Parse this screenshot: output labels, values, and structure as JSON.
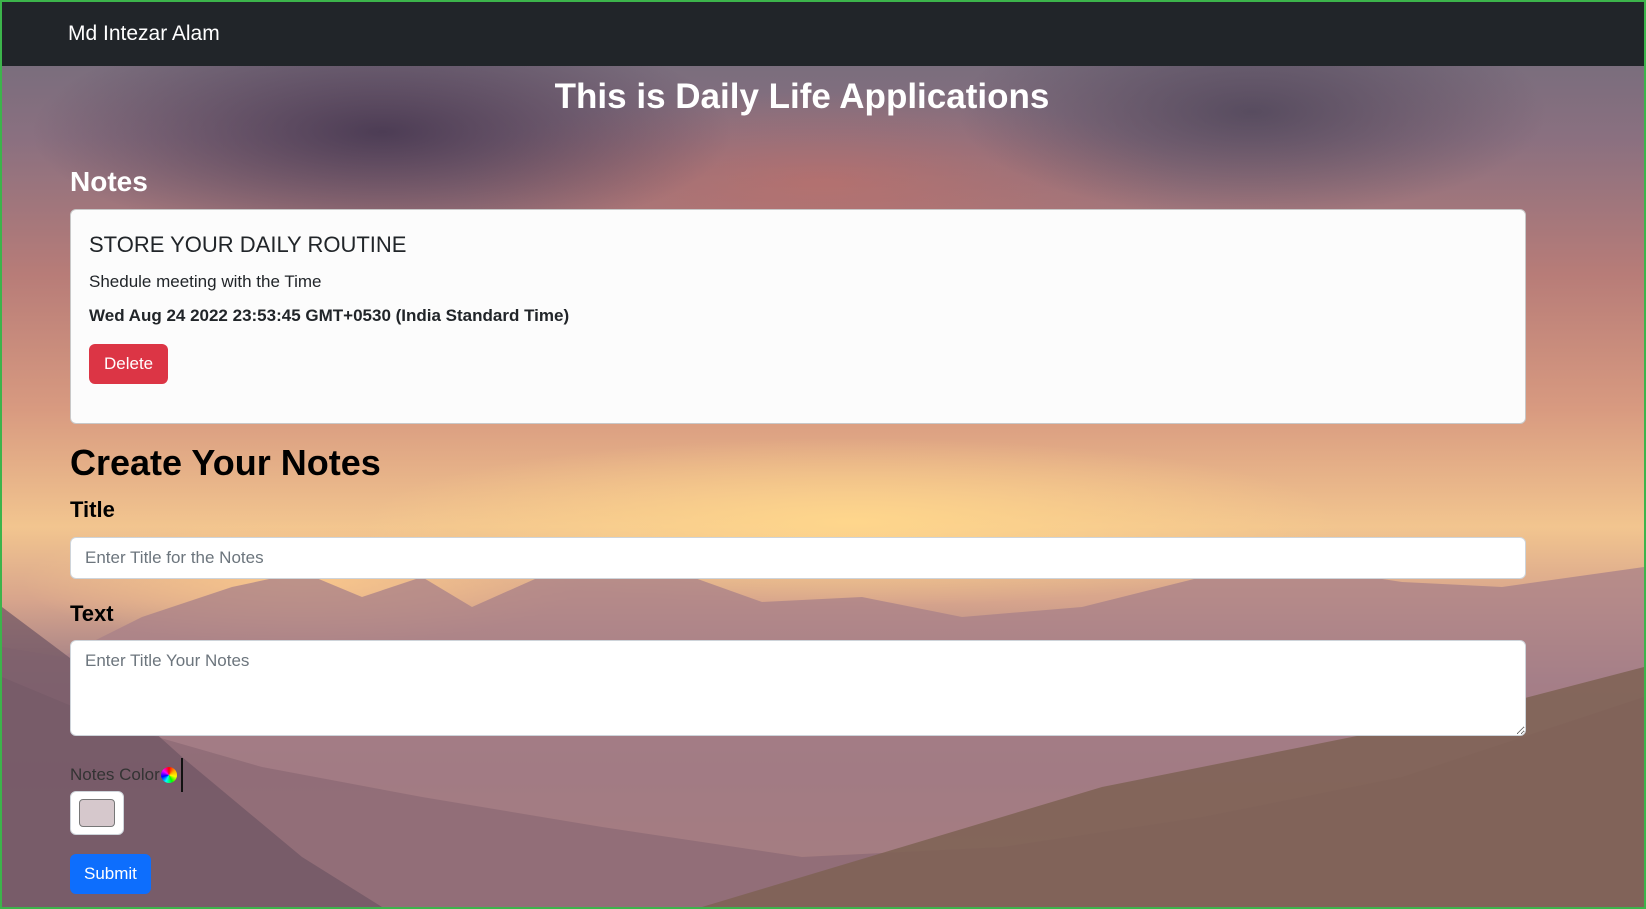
{
  "navbar": {
    "brand": "Md Intezar Alam"
  },
  "page_title": "This is Daily Life Applications",
  "notes_section": {
    "heading": "Notes",
    "notes": [
      {
        "title": "STORE YOUR DAILY ROUTINE",
        "text": "Shedule meeting with the Time",
        "date": "Wed Aug 24 2022 23:53:45 GMT+0530 (India Standard Time)",
        "delete_label": "Delete",
        "color": "#fcfcfc"
      }
    ]
  },
  "create_form": {
    "heading": "Create Your Notes",
    "title_label": "Title",
    "title_placeholder": "Enter Title for the Notes",
    "title_value": "",
    "text_label": "Text",
    "text_placeholder": "Enter Title Your Notes",
    "text_value": "",
    "color_label": "Notes Color",
    "color_icon": "palette-icon",
    "color_value": "#d6c8cc",
    "submit_label": "Submit"
  },
  "colors": {
    "navbar_bg": "#212529",
    "delete_button": "#dc3545",
    "submit_button": "#0d6efd"
  }
}
